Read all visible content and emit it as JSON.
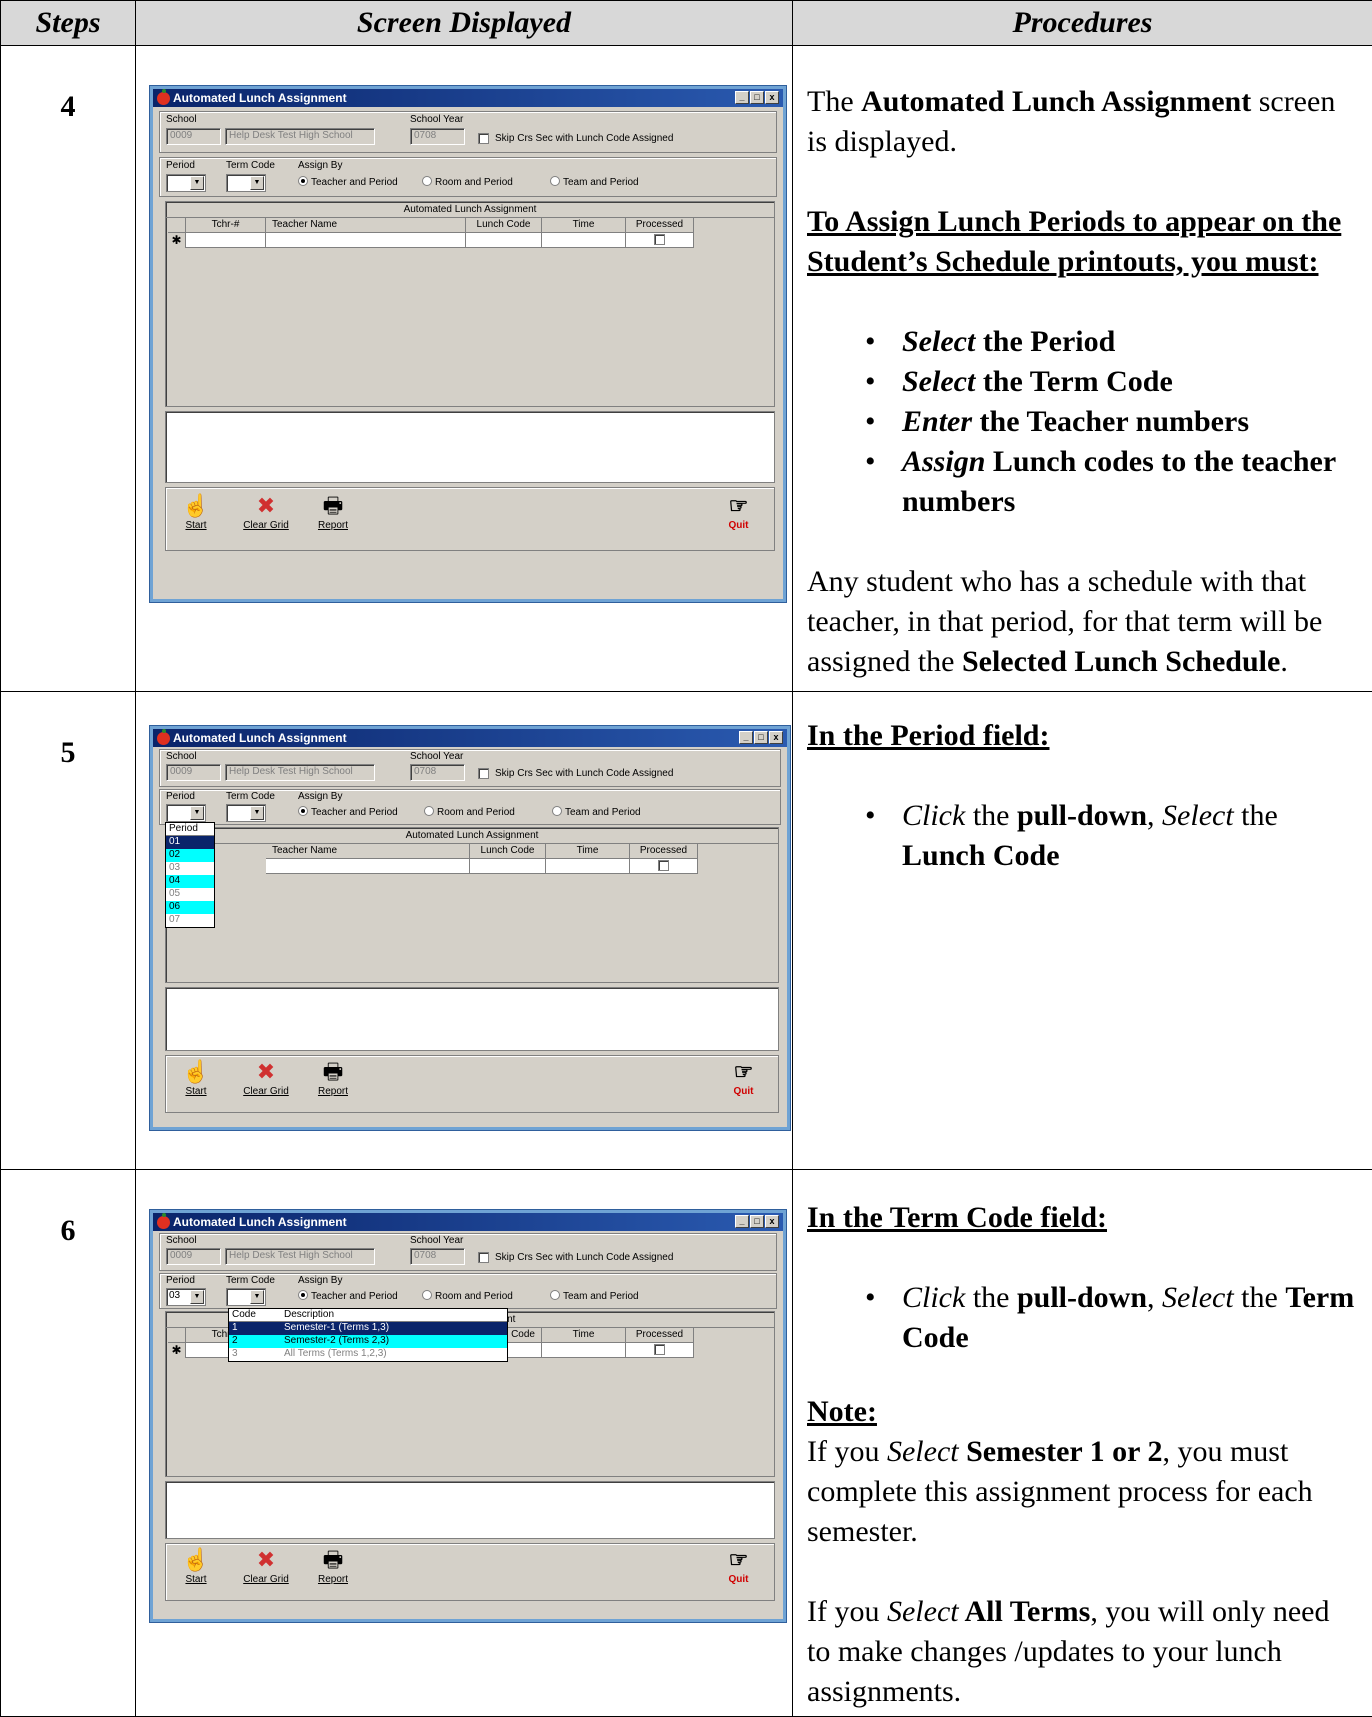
{
  "header": {
    "steps": "Steps",
    "screen": "Screen Displayed",
    "procedures": "Procedures"
  },
  "window": {
    "title": "Automated Lunch Assignment",
    "school_label": "School",
    "school_code": "0009",
    "school_name": "Help Desk Test High School",
    "school_year_label": "School Year",
    "school_year": "0708",
    "skip_label": "Skip Crs Sec with Lunch Code Assigned",
    "period_label": "Period",
    "term_code_label": "Term Code",
    "assign_by_label": "Assign By",
    "radio_teacher": "Teacher and Period",
    "radio_room": "Room and Period",
    "radio_team": "Team and Period",
    "grid_title": "Automated Lunch Assignment",
    "col_tchr": "Tchr-#",
    "col_name": "Teacher Name",
    "col_lunch": "Lunch Code",
    "col_time": "Time",
    "col_processed": "Processed",
    "new_row_marker": "✱",
    "btn_start": "Start",
    "btn_clear": "Clear Grid",
    "btn_report": "Report",
    "btn_quit": "Quit",
    "minimize": "_",
    "maximize": "□",
    "close": "x"
  },
  "step4": {
    "num": "4",
    "p1_a": "The ",
    "p1_b": "Automated Lunch Assignment",
    "p1_c": " screen is displayed.",
    "heading": "To Assign Lunch Periods to appear on the Student’s Schedule printouts, you must:",
    "b1_i": "Select",
    "b1_b": " the Period",
    "b2_i": "Select",
    "b2_b": " the Term Code",
    "b3_i": "Enter",
    "b3_b": " the Teacher numbers",
    "b4_i": "Assign",
    "b4_b": " Lunch codes to the teacher numbers",
    "p2_a": "Any student who has a schedule with that teacher, in that period, for that term will be assigned the ",
    "p2_b": "Selected Lunch Schedule",
    "p2_c": "."
  },
  "step5": {
    "num": "5",
    "heading": "In the Period field:",
    "b_i1": "Click",
    "b_t1": "  the ",
    "b_b1": "pull-down",
    "b_t2": ", ",
    "b_i2": "Select",
    "b_t3": " the ",
    "b_b2": "Lunch Code",
    "dropdown_header": "Period",
    "dropdown_items": [
      "01",
      "02",
      "03",
      "04",
      "05",
      "06",
      "07"
    ]
  },
  "step6": {
    "num": "6",
    "heading": "In the Term Code field:",
    "b_i1": "Click",
    "b_t1": " the ",
    "b_b1": "pull-down",
    "b_t2": ", ",
    "b_i2": "Select",
    "b_t3": " the ",
    "b_b2": "Term Code",
    "note_heading": "Note: ",
    "note_a": "If you ",
    "note_i": "Select",
    "note_b": " Semester 1 or 2",
    "note_c": ", you must complete this assignment process for each semester.",
    "note2_a": "If you ",
    "note2_i": "Select",
    "note2_b": " All Terms",
    "note2_c": ", you will only need to make changes /updates to your lunch assignments.",
    "period_value": "03",
    "grid_title_partial": "nent",
    "col_lunch_partial": "ch Code",
    "dd_col_code": "Code",
    "dd_col_desc": "Description",
    "dd_rows": [
      {
        "code": "1",
        "desc": "Semester-1 (Terms 1,3)"
      },
      {
        "code": "2",
        "desc": "Semester-2 (Terms 2,3)"
      },
      {
        "code": "3",
        "desc": "All Terms (Terms 1,2,3)"
      }
    ]
  }
}
